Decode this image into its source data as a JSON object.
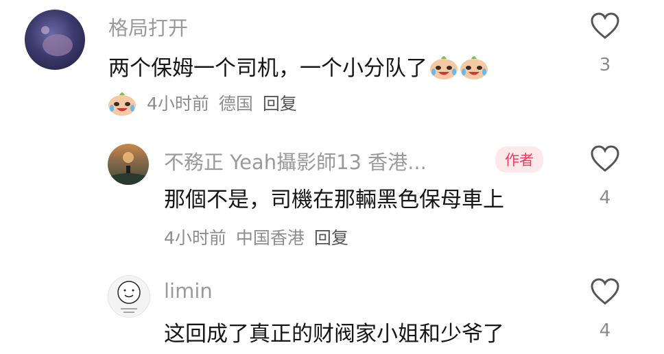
{
  "comments": [
    {
      "username": "格局打开",
      "text": "两个保姆一个司机，一个小分队了",
      "emoji_name": "crying-laughing-icon",
      "time": "4小时前",
      "location": "德国",
      "reply_label": "回复",
      "likes": "3"
    },
    {
      "username": "不務正 Yeah攝影師13 香港...",
      "badge": "作者",
      "text": "那個不是，司機在那輛黑色保母車上",
      "time": "4小时前",
      "location": "中国香港",
      "reply_label": "回复",
      "likes": "4"
    },
    {
      "username": "limin",
      "text": "这回成了真正的财阀家小姐和少爷了",
      "likes": "4"
    }
  ],
  "colors": {
    "username": "#9a9a9a",
    "text": "#161616",
    "meta": "#8c8c8c",
    "badge_bg": "#fde8ec",
    "badge_text": "#f03a5a"
  }
}
